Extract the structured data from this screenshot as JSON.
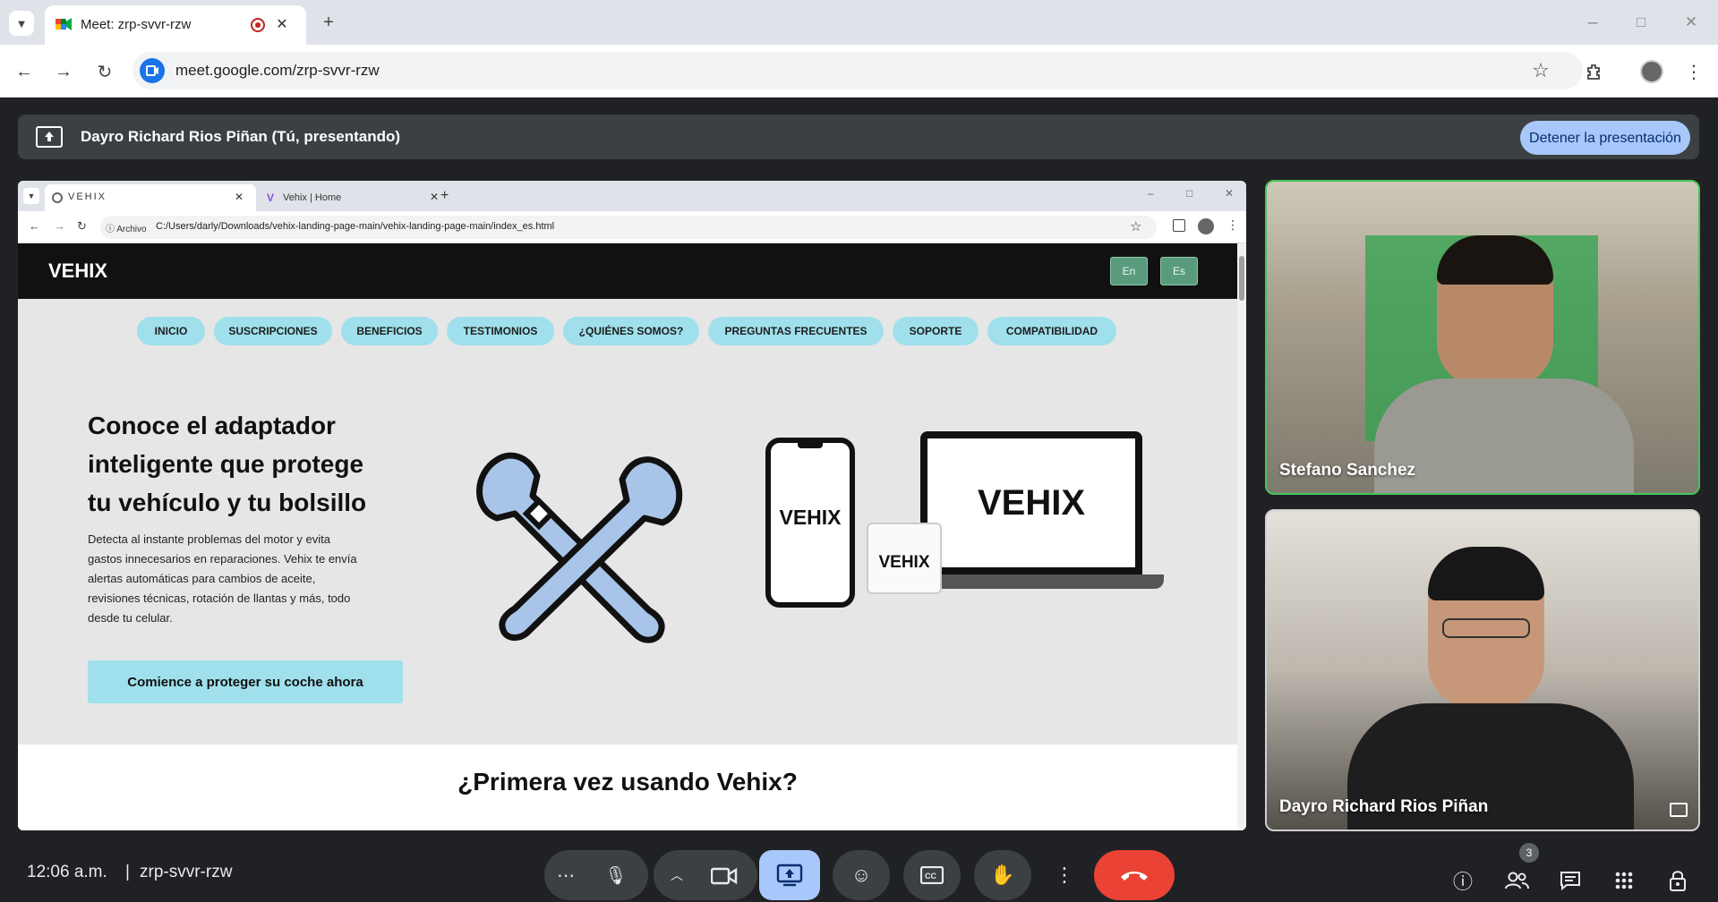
{
  "browser": {
    "tab_title": "Meet: zrp-svvr-rzw",
    "new_tab": "+",
    "url": "meet.google.com/zrp-svvr-rzw",
    "window_controls": [
      "–",
      "□",
      "✕"
    ]
  },
  "present_bar": {
    "text": "Dayro Richard Rios Piñan (Tú, presentando)",
    "stop_label": "Detener la presentación"
  },
  "shared": {
    "tabs": [
      {
        "title": "VEHIX",
        "close": "✕"
      },
      {
        "title": "Vehix | Home",
        "close": "✕"
      }
    ],
    "new_tab": "+",
    "window_controls": [
      "–",
      "□",
      "✕"
    ],
    "site_chip": "Archivo",
    "url": "C:/Users/darly/Downloads/vehix-landing-page-main/vehix-landing-page-main/index_es.html",
    "site": {
      "logo": "VEHIX",
      "langs": [
        "En",
        "Es"
      ],
      "nav": [
        "INICIO",
        "SUSCRIPCIONES",
        "BENEFICIOS",
        "TESTIMONIOS",
        "¿QUIÉNES SOMOS?",
        "PREGUNTAS FRECUENTES",
        "SOPORTE",
        "COMPATIBILIDAD"
      ],
      "hero_title": [
        "Conoce el adaptador",
        "inteligente que protege",
        "tu vehículo y tu bolsillo"
      ],
      "hero_text": [
        "Detecta al instante problemas del motor y evita",
        "gastos innecesarios en reparaciones. Vehix te envía",
        "alertas automáticas para cambios de aceite,",
        "revisiones técnicas, rotación de llantas y más, todo",
        "desde tu celular."
      ],
      "cta": "Comience a proteger su coche ahora",
      "phone_label": "VEHIX",
      "laptop_label": "VEHIX",
      "device_label": "VEHIX",
      "section_title": "¿Primera vez usando Vehix?"
    }
  },
  "participants": [
    {
      "name": "Stefano Sanchez"
    },
    {
      "name": "Dayro Richard Rios Piñan"
    }
  ],
  "footer": {
    "time": "12:06 a.m.",
    "separator": "|",
    "meeting_code": "zrp-svvr-rzw",
    "participant_count": "3"
  },
  "colors": {
    "accent": "#a8c7fa",
    "end_call": "#ea4335",
    "nav_pill": "#9fe0ec",
    "speaking_border": "#44c35a"
  }
}
